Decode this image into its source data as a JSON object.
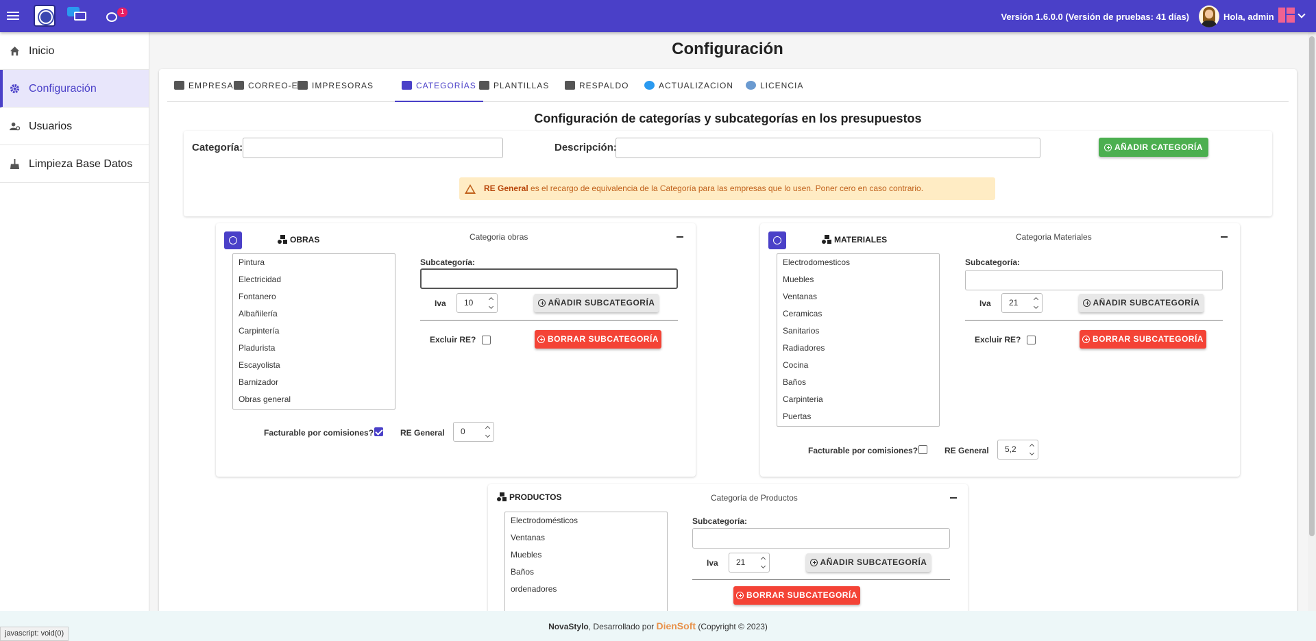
{
  "topbar": {
    "notification_count": "1",
    "version": "Versión 1.6.0.0 (Versión de pruebas: 41 días)",
    "greeting": "Hola, admin",
    "bg_color": "#4a40c8"
  },
  "sidebar": {
    "items": [
      {
        "label": "Inicio",
        "icon": "home-icon"
      },
      {
        "label": "Configuración",
        "icon": "gear-icon",
        "active": true
      },
      {
        "label": "Usuarios",
        "icon": "users-gear-icon"
      },
      {
        "label": "Limpieza Base Datos",
        "icon": "broom-icon"
      }
    ]
  },
  "page": {
    "title": "Configuración"
  },
  "tabs": [
    {
      "label": "EMPRESA",
      "icon": "building-icon"
    },
    {
      "label": "CORREO-E",
      "icon": "envelope-icon"
    },
    {
      "label": "IMPRESORAS",
      "icon": "printer-icon"
    },
    {
      "label": "CATEGORÍAS",
      "icon": "folder-icon",
      "active": true
    },
    {
      "label": "PLANTILLAS",
      "icon": "template-icon"
    },
    {
      "label": "RESPALDO",
      "icon": "backup-icon"
    },
    {
      "label": "ACTUALIZACION",
      "icon": "refresh-icon"
    },
    {
      "label": "LICENCIA",
      "icon": "license-icon"
    }
  ],
  "section": {
    "title": "Configuración de categorías y subcategorías en los presupuestos",
    "category_label": "Categoría:",
    "category_value": "",
    "description_label": "Descripción:",
    "description_value": "",
    "add_category_button": "AÑADIR CATEGORÍA",
    "alert_bold": "RE General",
    "alert_text": " es el recargo de equivalencia de la Categoría para las empresas que lo usen. Poner cero en caso contrario."
  },
  "labels": {
    "subcategory": "Subcategoría:",
    "iva": "Iva",
    "add_sub": "AÑADIR SUBCATEGORÍA",
    "exclude_re": "Excluir RE?",
    "delete_sub": "BORRAR SUBCATEGORÍA",
    "billable": "Facturable por comisiones?",
    "re_general": "RE General"
  },
  "categories": {
    "obras": {
      "name": "OBRAS",
      "description": "Categoria obras",
      "subcategories": [
        "Pintura",
        "Electricidad",
        "Fontanero",
        "Albañilería",
        "Carpintería",
        "Pladurista",
        "Escayolista",
        "Barnizador",
        "Obras general"
      ],
      "subcategory_value": "",
      "iva": "10",
      "exclude_re": false,
      "billable": true,
      "re_general": "0"
    },
    "materiales": {
      "name": "MATERIALES",
      "description": "Categoria Materiales",
      "subcategories": [
        "Electrodomesticos",
        "Muebles",
        "Ventanas",
        "Ceramicas",
        "Sanitarios",
        "Radiadores",
        "Cocina",
        "Baños",
        "Carpinteria",
        "Puertas"
      ],
      "subcategory_value": "",
      "iva": "21",
      "exclude_re": false,
      "billable": false,
      "re_general": "5,2"
    },
    "productos": {
      "name": "PRODUCTOS",
      "description": "Categoría de Productos",
      "subcategories": [
        "Electrodomésticos",
        "Ventanas",
        "Muebles",
        "Baños",
        "ordenadores"
      ],
      "subcategory_value": "",
      "iva": "21"
    }
  },
  "footer": {
    "prefix": "NovaStylo",
    "middle": ", Desarrollado por ",
    "brand": "DienSoft",
    "suffix": " (Copyright © 2023)"
  },
  "statusbar": {
    "text": "javascript: void(0)"
  },
  "colors": {
    "primary": "#4a40c8",
    "success": "#4caf50",
    "danger": "#f44336",
    "warning_bg": "#ffecc4"
  }
}
